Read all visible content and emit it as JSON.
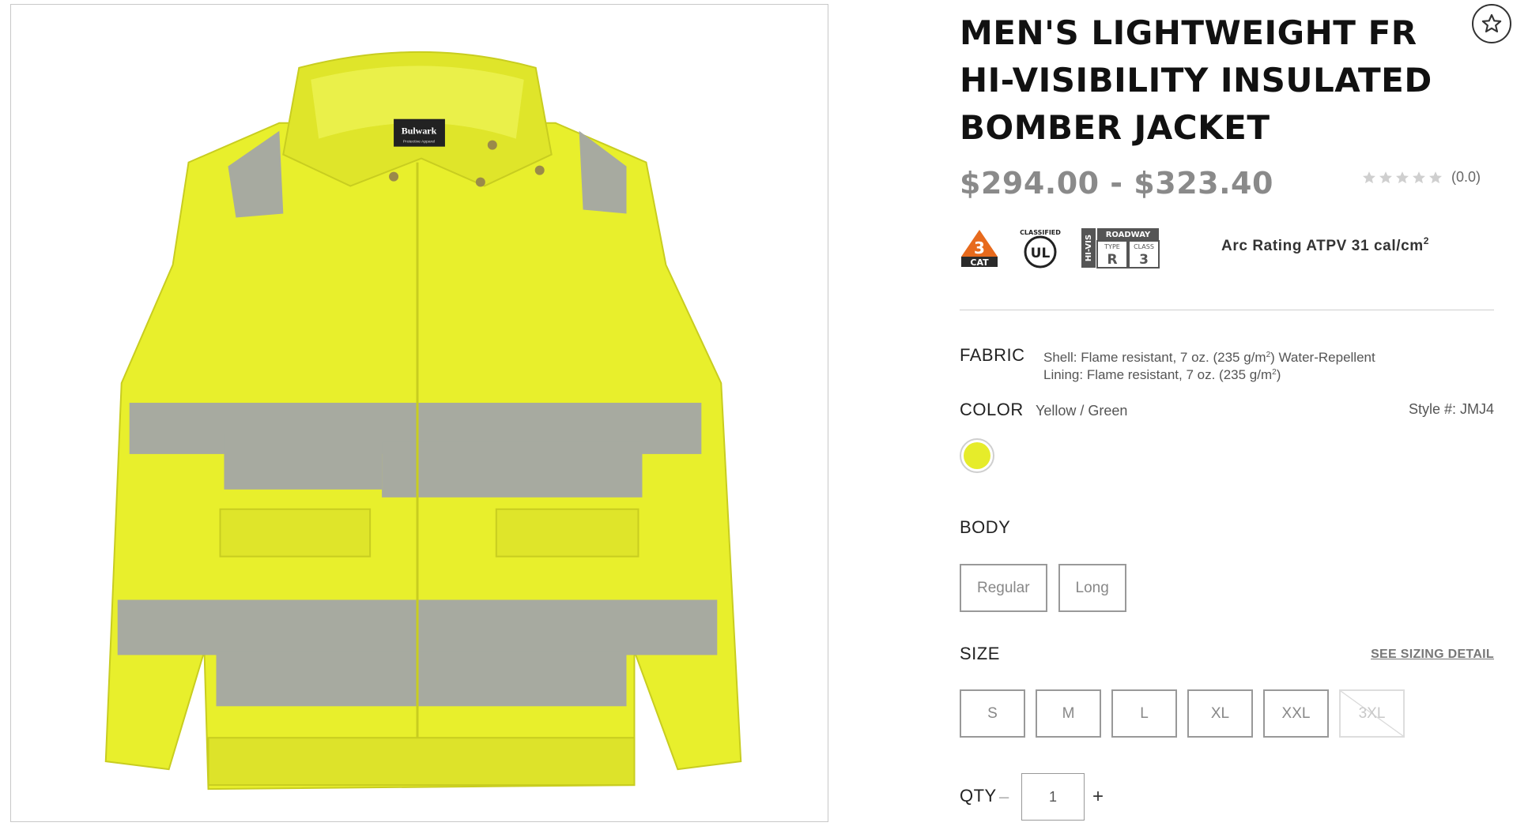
{
  "product": {
    "title": "MEN'S LIGHTWEIGHT FR HI-VISIBILITY INSULATED BOMBER JACKET",
    "price": "$294.00 - $323.40",
    "rating_count": "(0.0)",
    "rating_stars": 0,
    "arc_rating": "Arc Rating ATPV 31 cal/cm",
    "arc_rating_sup": "2",
    "style_number": "Style #: JMJ4"
  },
  "badges": {
    "cat_number": "3",
    "cat_label": "CAT",
    "ul_top": "CLASSIFIED",
    "ul_mark": "UL",
    "hivis_side": "HI-VIS",
    "hivis_top": "ROADWAY",
    "hivis_type": "TYPE",
    "hivis_type_val": "R",
    "hivis_class": "CLASS",
    "hivis_class_val": "3"
  },
  "fabric": {
    "label": "FABRIC",
    "line1_pre": "Shell: Flame resistant, 7 oz. (235 g/m",
    "line1_sup": "2",
    "line1_post": ") Water-Repellent",
    "line2_pre": "Lining: Flame resistant, 7 oz. (235 g/m",
    "line2_sup": "2",
    "line2_post": ")"
  },
  "color": {
    "label": "COLOR",
    "value": "Yellow / Green",
    "swatch_hex": "#e6ec2a"
  },
  "body": {
    "label": "BODY",
    "options": [
      "Regular",
      "Long"
    ]
  },
  "size": {
    "label": "SIZE",
    "sizing_link": "SEE SIZING DETAIL",
    "options": [
      "S",
      "M",
      "L",
      "XL",
      "XXL",
      "3XL"
    ],
    "unavailable": [
      "3XL"
    ]
  },
  "qty": {
    "label": "QTY",
    "minus": "–",
    "value": "1",
    "plus": "+"
  },
  "image": {
    "brand_label": "Bulwark",
    "brand_sub": "Protective Apparel"
  },
  "colors": {
    "jacket": "#e8ef2c",
    "reflective": "#a7aaa0",
    "cat_orange": "#e76a1d"
  }
}
